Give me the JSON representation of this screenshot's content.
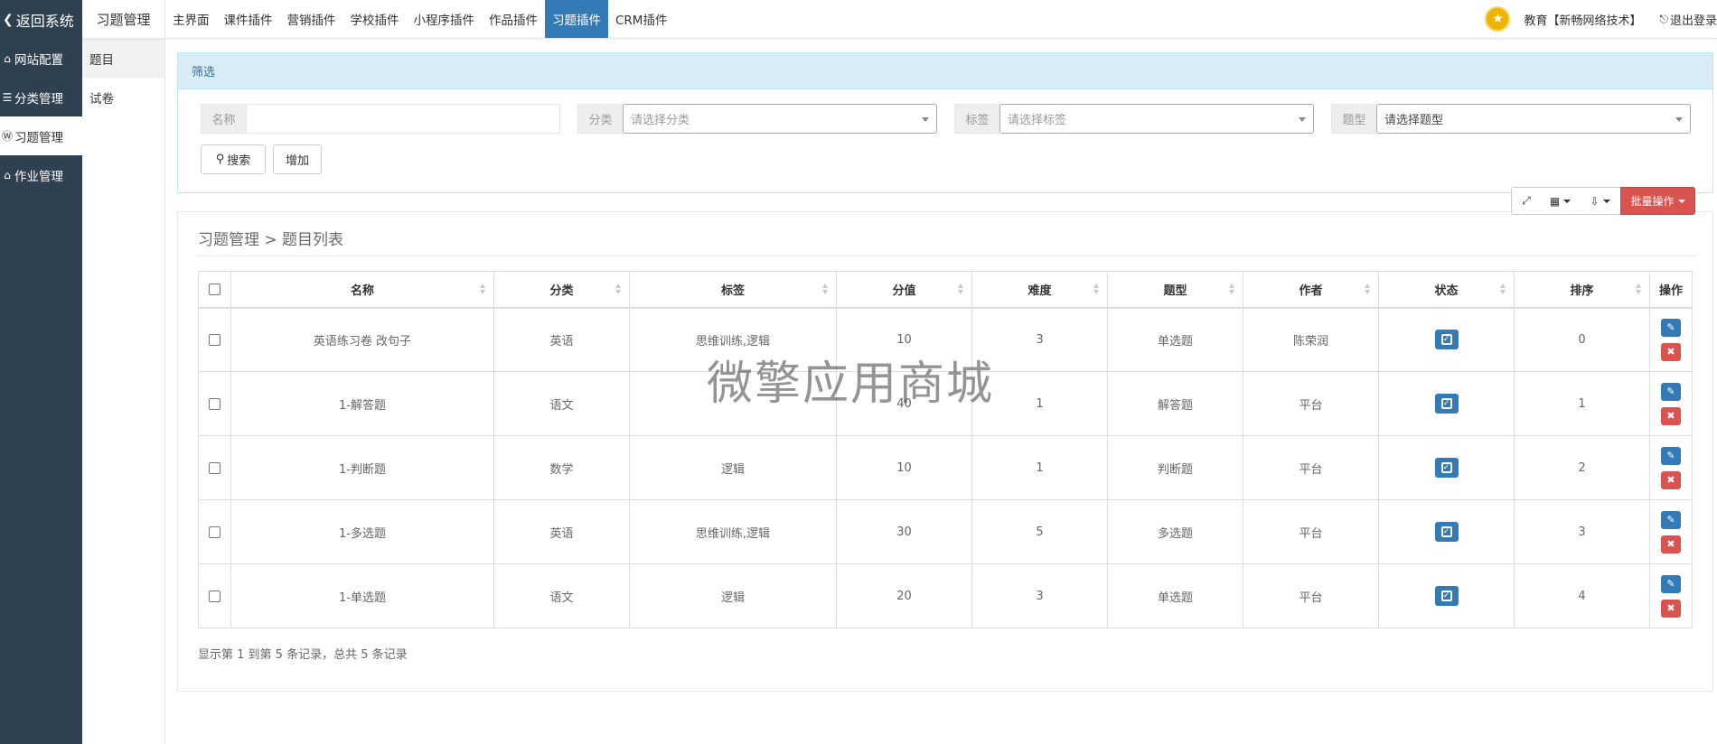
{
  "sidebar": {
    "back_label": "返回系统",
    "items": [
      {
        "label": "网站配置",
        "icon": "home-icon"
      },
      {
        "label": "分类管理",
        "icon": "list-icon"
      },
      {
        "label": "习题管理",
        "icon": "wordpress-icon"
      },
      {
        "label": "作业管理",
        "icon": "graduation-cap-icon"
      }
    ]
  },
  "subnav": {
    "items": [
      {
        "label": "题目"
      },
      {
        "label": "试卷"
      }
    ]
  },
  "topbar": {
    "module_title": "习题管理",
    "nav": [
      "主界面",
      "课件插件",
      "营销插件",
      "学校插件",
      "小程序插件",
      "作品插件",
      "习题插件",
      "CRM插件"
    ],
    "active_nav": "习题插件",
    "user": "教育【新畅网络技术】",
    "logout": "退出登录"
  },
  "filter": {
    "title": "筛选",
    "name_label": "名称",
    "name_value": "",
    "category_label": "分类",
    "category_placeholder": "请选择分类",
    "tag_label": "标签",
    "tag_placeholder": "请选择标签",
    "type_label": "题型",
    "type_value": "请选择题型",
    "search_button": "搜索",
    "add_button": "增加"
  },
  "toolbar": {
    "batch_label": "批量操作"
  },
  "list": {
    "breadcrumb": "习题管理 > 题目列表",
    "columns": [
      "名称",
      "分类",
      "标签",
      "分值",
      "难度",
      "题型",
      "作者",
      "状态",
      "排序",
      "操作"
    ],
    "rows": [
      {
        "name": "英语练习卷 改句子",
        "category": "英语",
        "tags": "思维训练,逻辑",
        "score": "10",
        "difficulty": "3",
        "type": "单选题",
        "author": "陈荣润",
        "order": "0"
      },
      {
        "name": "1-解答题",
        "category": "语文",
        "tags": "",
        "score": "40",
        "difficulty": "1",
        "type": "解答题",
        "author": "平台",
        "order": "1"
      },
      {
        "name": "1-判断题",
        "category": "数学",
        "tags": "逻辑",
        "score": "10",
        "difficulty": "1",
        "type": "判断题",
        "author": "平台",
        "order": "2"
      },
      {
        "name": "1-多选题",
        "category": "英语",
        "tags": "思维训练,逻辑",
        "score": "30",
        "difficulty": "5",
        "type": "多选题",
        "author": "平台",
        "order": "3"
      },
      {
        "name": "1-单选题",
        "category": "语文",
        "tags": "逻辑",
        "score": "20",
        "difficulty": "3",
        "type": "单选题",
        "author": "平台",
        "order": "4"
      }
    ],
    "pager_text": "显示第 1 到第 5 条记录，总共 5 条记录"
  },
  "watermark": "微擎应用商城",
  "colors": {
    "sidebar_bg": "#2f4050",
    "primary": "#337ab7",
    "danger": "#d9534f",
    "info_bg": "#d9edf7"
  }
}
